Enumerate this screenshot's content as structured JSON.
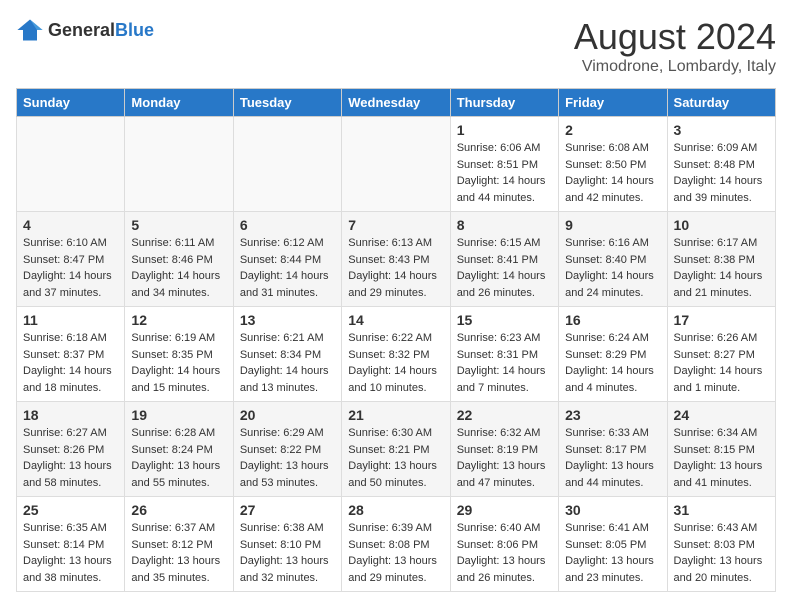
{
  "header": {
    "logo_general": "General",
    "logo_blue": "Blue",
    "month_year": "August 2024",
    "location": "Vimodrone, Lombardy, Italy"
  },
  "days_of_week": [
    "Sunday",
    "Monday",
    "Tuesday",
    "Wednesday",
    "Thursday",
    "Friday",
    "Saturday"
  ],
  "weeks": [
    [
      {
        "day": "",
        "info": ""
      },
      {
        "day": "",
        "info": ""
      },
      {
        "day": "",
        "info": ""
      },
      {
        "day": "",
        "info": ""
      },
      {
        "day": "1",
        "info": "Sunrise: 6:06 AM\nSunset: 8:51 PM\nDaylight: 14 hours\nand 44 minutes."
      },
      {
        "day": "2",
        "info": "Sunrise: 6:08 AM\nSunset: 8:50 PM\nDaylight: 14 hours\nand 42 minutes."
      },
      {
        "day": "3",
        "info": "Sunrise: 6:09 AM\nSunset: 8:48 PM\nDaylight: 14 hours\nand 39 minutes."
      }
    ],
    [
      {
        "day": "4",
        "info": "Sunrise: 6:10 AM\nSunset: 8:47 PM\nDaylight: 14 hours\nand 37 minutes."
      },
      {
        "day": "5",
        "info": "Sunrise: 6:11 AM\nSunset: 8:46 PM\nDaylight: 14 hours\nand 34 minutes."
      },
      {
        "day": "6",
        "info": "Sunrise: 6:12 AM\nSunset: 8:44 PM\nDaylight: 14 hours\nand 31 minutes."
      },
      {
        "day": "7",
        "info": "Sunrise: 6:13 AM\nSunset: 8:43 PM\nDaylight: 14 hours\nand 29 minutes."
      },
      {
        "day": "8",
        "info": "Sunrise: 6:15 AM\nSunset: 8:41 PM\nDaylight: 14 hours\nand 26 minutes."
      },
      {
        "day": "9",
        "info": "Sunrise: 6:16 AM\nSunset: 8:40 PM\nDaylight: 14 hours\nand 24 minutes."
      },
      {
        "day": "10",
        "info": "Sunrise: 6:17 AM\nSunset: 8:38 PM\nDaylight: 14 hours\nand 21 minutes."
      }
    ],
    [
      {
        "day": "11",
        "info": "Sunrise: 6:18 AM\nSunset: 8:37 PM\nDaylight: 14 hours\nand 18 minutes."
      },
      {
        "day": "12",
        "info": "Sunrise: 6:19 AM\nSunset: 8:35 PM\nDaylight: 14 hours\nand 15 minutes."
      },
      {
        "day": "13",
        "info": "Sunrise: 6:21 AM\nSunset: 8:34 PM\nDaylight: 14 hours\nand 13 minutes."
      },
      {
        "day": "14",
        "info": "Sunrise: 6:22 AM\nSunset: 8:32 PM\nDaylight: 14 hours\nand 10 minutes."
      },
      {
        "day": "15",
        "info": "Sunrise: 6:23 AM\nSunset: 8:31 PM\nDaylight: 14 hours\nand 7 minutes."
      },
      {
        "day": "16",
        "info": "Sunrise: 6:24 AM\nSunset: 8:29 PM\nDaylight: 14 hours\nand 4 minutes."
      },
      {
        "day": "17",
        "info": "Sunrise: 6:26 AM\nSunset: 8:27 PM\nDaylight: 14 hours\nand 1 minute."
      }
    ],
    [
      {
        "day": "18",
        "info": "Sunrise: 6:27 AM\nSunset: 8:26 PM\nDaylight: 13 hours\nand 58 minutes."
      },
      {
        "day": "19",
        "info": "Sunrise: 6:28 AM\nSunset: 8:24 PM\nDaylight: 13 hours\nand 55 minutes."
      },
      {
        "day": "20",
        "info": "Sunrise: 6:29 AM\nSunset: 8:22 PM\nDaylight: 13 hours\nand 53 minutes."
      },
      {
        "day": "21",
        "info": "Sunrise: 6:30 AM\nSunset: 8:21 PM\nDaylight: 13 hours\nand 50 minutes."
      },
      {
        "day": "22",
        "info": "Sunrise: 6:32 AM\nSunset: 8:19 PM\nDaylight: 13 hours\nand 47 minutes."
      },
      {
        "day": "23",
        "info": "Sunrise: 6:33 AM\nSunset: 8:17 PM\nDaylight: 13 hours\nand 44 minutes."
      },
      {
        "day": "24",
        "info": "Sunrise: 6:34 AM\nSunset: 8:15 PM\nDaylight: 13 hours\nand 41 minutes."
      }
    ],
    [
      {
        "day": "25",
        "info": "Sunrise: 6:35 AM\nSunset: 8:14 PM\nDaylight: 13 hours\nand 38 minutes."
      },
      {
        "day": "26",
        "info": "Sunrise: 6:37 AM\nSunset: 8:12 PM\nDaylight: 13 hours\nand 35 minutes."
      },
      {
        "day": "27",
        "info": "Sunrise: 6:38 AM\nSunset: 8:10 PM\nDaylight: 13 hours\nand 32 minutes."
      },
      {
        "day": "28",
        "info": "Sunrise: 6:39 AM\nSunset: 8:08 PM\nDaylight: 13 hours\nand 29 minutes."
      },
      {
        "day": "29",
        "info": "Sunrise: 6:40 AM\nSunset: 8:06 PM\nDaylight: 13 hours\nand 26 minutes."
      },
      {
        "day": "30",
        "info": "Sunrise: 6:41 AM\nSunset: 8:05 PM\nDaylight: 13 hours\nand 23 minutes."
      },
      {
        "day": "31",
        "info": "Sunrise: 6:43 AM\nSunset: 8:03 PM\nDaylight: 13 hours\nand 20 minutes."
      }
    ]
  ]
}
